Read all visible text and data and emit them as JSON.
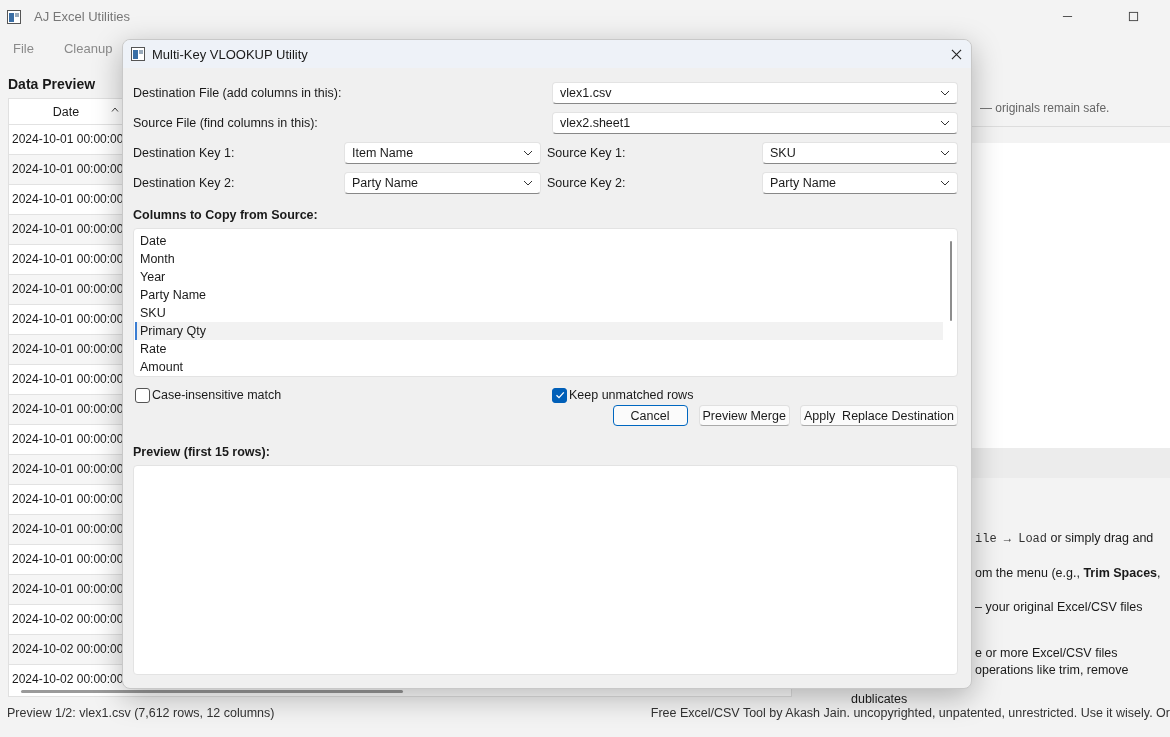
{
  "main_window": {
    "title": "AJ Excel Utilities",
    "menu": [
      {
        "label": "File"
      },
      {
        "label": "Cleanup"
      }
    ],
    "data_preview": {
      "title": "Data Preview",
      "columns": [
        {
          "label": "Date",
          "sorted": true
        }
      ],
      "rows": [
        [
          "2024-10-01 00:00:00"
        ],
        [
          "2024-10-01 00:00:00"
        ],
        [
          "2024-10-01 00:00:00"
        ],
        [
          "2024-10-01 00:00:00"
        ],
        [
          "2024-10-01 00:00:00"
        ],
        [
          "2024-10-01 00:00:00"
        ],
        [
          "2024-10-01 00:00:00"
        ],
        [
          "2024-10-01 00:00:00"
        ],
        [
          "2024-10-01 00:00:00"
        ],
        [
          "2024-10-01 00:00:00"
        ],
        [
          "2024-10-01 00:00:00"
        ],
        [
          "2024-10-01 00:00:00"
        ],
        [
          "2024-10-01 00:00:00"
        ],
        [
          "2024-10-01 00:00:00"
        ],
        [
          "2024-10-01 00:00:00"
        ],
        [
          "2024-10-01 00:00:00"
        ],
        [
          "2024-10-02 00:00:00"
        ],
        [
          "2024-10-02 00:00:00"
        ],
        [
          "2024-10-02 00:00:00"
        ]
      ]
    },
    "info_panel": {
      "note": "— originals remain safe.",
      "paragraphs": [
        [
          [
            {
              "kind": "code",
              "text": "ile → Load"
            },
            {
              "kind": "plain",
              "text": " or simply drag and"
            }
          ]
        ],
        [
          [
            {
              "kind": "plain",
              "text": "om the menu (e.g., **Trim Spaces**,"
            }
          ]
        ],
        [
          [
            {
              "kind": "plain",
              "text": "– your original Excel/CSV files"
            }
          ]
        ],
        [
          [
            {
              "kind": "plain",
              "text": "e or more Excel/CSV files"
            }
          ],
          [
            {
              "kind": "plain",
              "text": "operations like trim, remove"
            }
          ],
          [
            {
              "kind": "plain",
              "text": "dublicates"
            }
          ]
        ]
      ]
    },
    "status_bar": {
      "left": "Preview 1/2: vlex1.csv (7,612 rows, 12 columns)",
      "right": "Free Excel/CSV Tool by Akash Jain. uncopyrighted, unpatented, unrestricted. Use it wisely. Or"
    }
  },
  "dialog": {
    "title": "Multi-Key VLOOKUP Utility",
    "files": [
      {
        "label": "Destination File (add columns in this):",
        "value": "vlex1.csv"
      },
      {
        "label": "Source File (find columns in this):",
        "value": "vlex2.sheet1"
      }
    ],
    "keys": [
      {
        "dest_label": "Destination Key 1:",
        "dest_value": "Item Name",
        "src_label": "Source Key 1:",
        "src_value": "SKU"
      },
      {
        "dest_label": "Destination Key 2:",
        "dest_value": "Party Name",
        "src_label": "Source Key 2:",
        "src_value": "Party Name"
      }
    ],
    "columns_title": "Columns to Copy from Source:",
    "columns": [
      {
        "label": "Date",
        "selected": false
      },
      {
        "label": "Month",
        "selected": false
      },
      {
        "label": "Year",
        "selected": false
      },
      {
        "label": "Party Name",
        "selected": false
      },
      {
        "label": "SKU",
        "selected": false
      },
      {
        "label": "Primary Qty",
        "selected": true
      },
      {
        "label": "Rate",
        "selected": false
      },
      {
        "label": "Amount",
        "selected": false
      }
    ],
    "options": [
      {
        "label": "Case-insensitive match",
        "checked": false
      },
      {
        "label": "Keep unmatched rows",
        "checked": true
      }
    ],
    "buttons": [
      {
        "label": "Cancel",
        "default": true
      },
      {
        "label": "Preview Merge",
        "default": false
      },
      {
        "label": "Apply  Replace Destination",
        "default": false
      }
    ],
    "preview_title": "Preview (first 15 rows):"
  }
}
